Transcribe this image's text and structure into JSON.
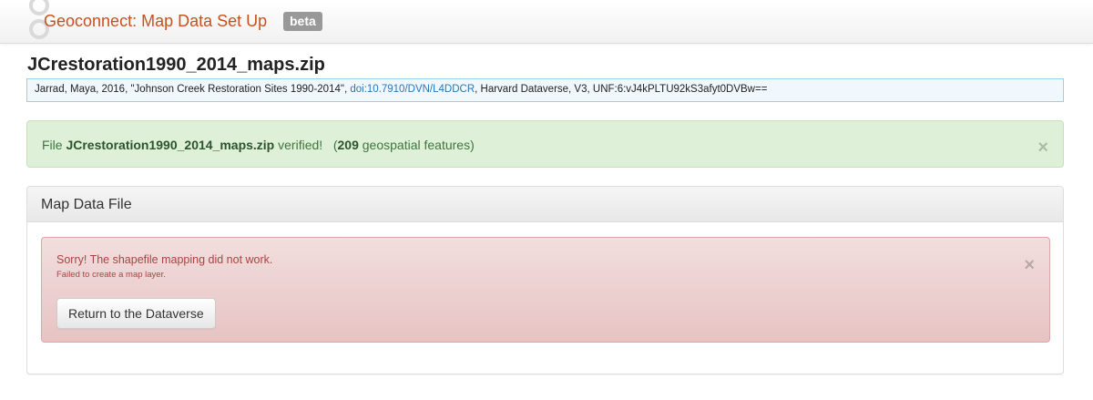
{
  "navbar": {
    "brand": "Geoconnect: Map Data Set Up",
    "badge": "beta",
    "logo_icon": "geoconnect-rings-logo"
  },
  "file": {
    "name": "JCrestoration1990_2014_maps.zip"
  },
  "citation": {
    "before": "Jarrad, Maya, 2016, \"Johnson Creek Restoration Sites 1990-2014\", ",
    "doi": "doi:10.7910/DVN/L4DDCR",
    "after": ", Harvard Dataverse, V3, UNF:6:vJ4kPLTU92kS3afyt0DVBw=="
  },
  "success_alert": {
    "prefix": "File ",
    "filename": "JCrestoration1990_2014_maps.zip",
    "verified": " verified!",
    "open_paren": "(",
    "count": "209",
    "suffix": " geospatial features)",
    "close": "×"
  },
  "panel": {
    "title": "Map Data File",
    "error": {
      "title": "Sorry! The shapefile mapping did not work.",
      "detail": "Failed to create a map layer.",
      "close": "×",
      "button": "Return to the Dataverse"
    }
  },
  "colors": {
    "brand": "#c8501e",
    "success_bg": "#dff0d8",
    "danger_bg": "#f2dede",
    "link": "#2a76b7"
  }
}
